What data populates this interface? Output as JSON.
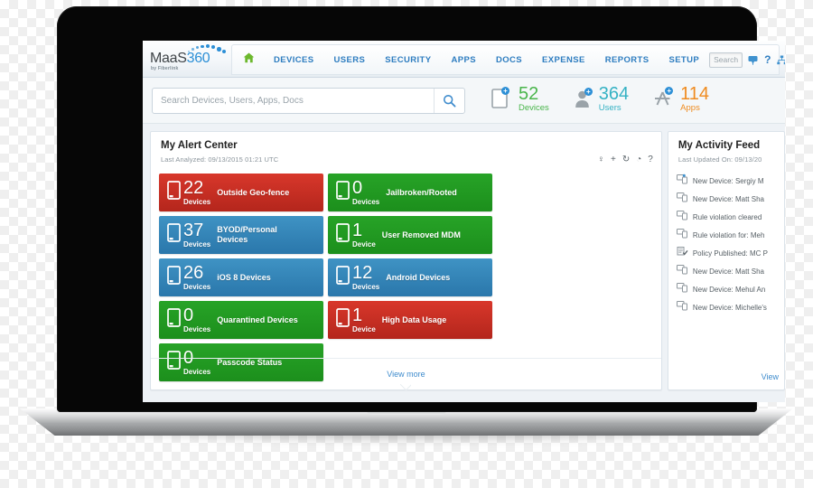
{
  "header": {
    "logo_main_left": "MaaS",
    "logo_main_right": "360",
    "logo_sub": "by Fiberlink",
    "home_icon": "home-icon",
    "nav_items": [
      {
        "label": "DEVICES"
      },
      {
        "label": "USERS"
      },
      {
        "label": "SECURITY"
      },
      {
        "label": "APPS"
      },
      {
        "label": "DOCS"
      },
      {
        "label": "EXPENSE"
      },
      {
        "label": "REPORTS"
      },
      {
        "label": "SETUP"
      }
    ],
    "search_placeholder": "Search",
    "search_value": "",
    "icons": [
      {
        "name": "chat-feedback-icon"
      },
      {
        "name": "help-question-icon"
      },
      {
        "name": "sitemap-icon"
      }
    ]
  },
  "subbar": {
    "search_placeholder": "Search Devices, Users, Apps, Docs",
    "search_value": "",
    "search_icon": "search-icon",
    "counters": [
      {
        "icon": "device-add-icon",
        "value": "52",
        "label": "Devices",
        "color": "#49b54b",
        "badge": "+"
      },
      {
        "icon": "user-add-icon",
        "value": "364",
        "label": "Users",
        "color": "#35b2c4",
        "badge": "+"
      },
      {
        "icon": "app-add-icon",
        "value": "114",
        "label": "Apps",
        "color": "#ef8b1f",
        "badge": "+"
      }
    ]
  },
  "alert_center": {
    "title": "My Alert Center",
    "subtitle": "Last Analyzed: 09/13/2015 01:21 UTC",
    "tools": [
      {
        "name": "pin-icon",
        "glyph": "♀"
      },
      {
        "name": "add-icon",
        "glyph": "+"
      },
      {
        "name": "refresh-icon",
        "glyph": "↻"
      },
      {
        "name": "clock-icon",
        "glyph": "◔"
      },
      {
        "name": "help-icon",
        "glyph": "?"
      }
    ],
    "tiles": [
      {
        "value": "22",
        "unit": "Devices",
        "label": "Outside Geo-fence",
        "color": "red"
      },
      {
        "value": "0",
        "unit": "Devices",
        "label": "Jailbroken/Rooted",
        "color": "green"
      },
      {
        "value": "37",
        "unit": "Devices",
        "label": "BYOD/Personal Devices",
        "color": "blue"
      },
      {
        "value": "1",
        "unit": "Device",
        "label": "User Removed MDM",
        "color": "green"
      },
      {
        "value": "26",
        "unit": "Devices",
        "label": "iOS 8 Devices",
        "color": "blue"
      },
      {
        "value": "12",
        "unit": "Devices",
        "label": "Android Devices",
        "color": "blue"
      },
      {
        "value": "0",
        "unit": "Devices",
        "label": "Quarantined Devices",
        "color": "green"
      },
      {
        "value": "1",
        "unit": "Device",
        "label": "High Data Usage",
        "color": "red"
      },
      {
        "value": "0",
        "unit": "Devices",
        "label": "Passcode Status",
        "color": "green"
      }
    ],
    "view_more": "View more"
  },
  "activity_feed": {
    "title": "My Activity Feed",
    "subtitle": "Last Updated On: 09/13/20",
    "items": [
      {
        "icon": "device-new-icon",
        "text": "New Device: Sergiy M"
      },
      {
        "icon": "device-new-icon",
        "text": "New Device: Matt Sha"
      },
      {
        "icon": "device-lock-icon",
        "text": "Rule violation cleared"
      },
      {
        "icon": "device-lock-icon",
        "text": "Rule violation for: Meh"
      },
      {
        "icon": "policy-icon",
        "text": "Policy Published: MC P"
      },
      {
        "icon": "device-new-icon",
        "text": "New Device: Matt Sha"
      },
      {
        "icon": "device-new-icon",
        "text": "New Device: Mehul An"
      },
      {
        "icon": "device-new-icon",
        "text": "New Device: Michelle's"
      }
    ],
    "view_more": "View"
  },
  "colors": {
    "brand_blue": "#2c8fd6",
    "tile_red": "#c72e22",
    "tile_green": "#22991f",
    "tile_blue": "#3585b8",
    "devices_green": "#49b54b",
    "users_teal": "#35b2c4",
    "apps_orange": "#ef8b1f"
  }
}
